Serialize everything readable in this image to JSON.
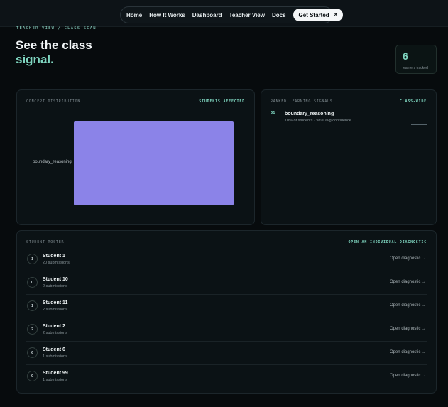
{
  "nav": {
    "items": [
      "Home",
      "How It Works",
      "Dashboard",
      "Teacher View",
      "Docs"
    ],
    "cta": "Get Started",
    "cta_icon": "arrow-up-right-icon"
  },
  "breadcrumb": "TEACHER VIEW / CLASS SCAN",
  "hero": {
    "title_line1": "See the class",
    "title_line2": "signal."
  },
  "stat": {
    "value": "6",
    "label": "learners tracked"
  },
  "distribution": {
    "heading": "CONCEPT DISTRIBUTION",
    "link": "STUDENTS AFFECTED",
    "bars": [
      {
        "label": "boundary_reasoning",
        "share": 1.0
      }
    ],
    "bar_color": "#8b83e8"
  },
  "signals": {
    "heading": "RANKED LEARNING SIGNALS",
    "link": "CLASS-WIDE",
    "items": [
      {
        "rank": "01",
        "name": "boundary_reasoning",
        "meta": "10% of students · 98% avg confidence"
      }
    ]
  },
  "roster": {
    "heading": "STUDENT ROSTER",
    "link": "OPEN AN INDIVIDUAL DIAGNOSTIC",
    "open_label": "Open diagnostic →",
    "students": [
      {
        "badge": "1",
        "name": "Student 1",
        "subs": "20 submissions"
      },
      {
        "badge": "0",
        "name": "Student 10",
        "subs": "2 submissions"
      },
      {
        "badge": "1",
        "name": "Student 11",
        "subs": "2 submissions"
      },
      {
        "badge": "2",
        "name": "Student 2",
        "subs": "2 submissions"
      },
      {
        "badge": "6",
        "name": "Student 6",
        "subs": "1 submissions"
      },
      {
        "badge": "9",
        "name": "Student 99",
        "subs": "1 submissions"
      }
    ]
  },
  "colors": {
    "accent": "#7fd6c0",
    "background": "#070b0d",
    "card": "#0b1215"
  }
}
